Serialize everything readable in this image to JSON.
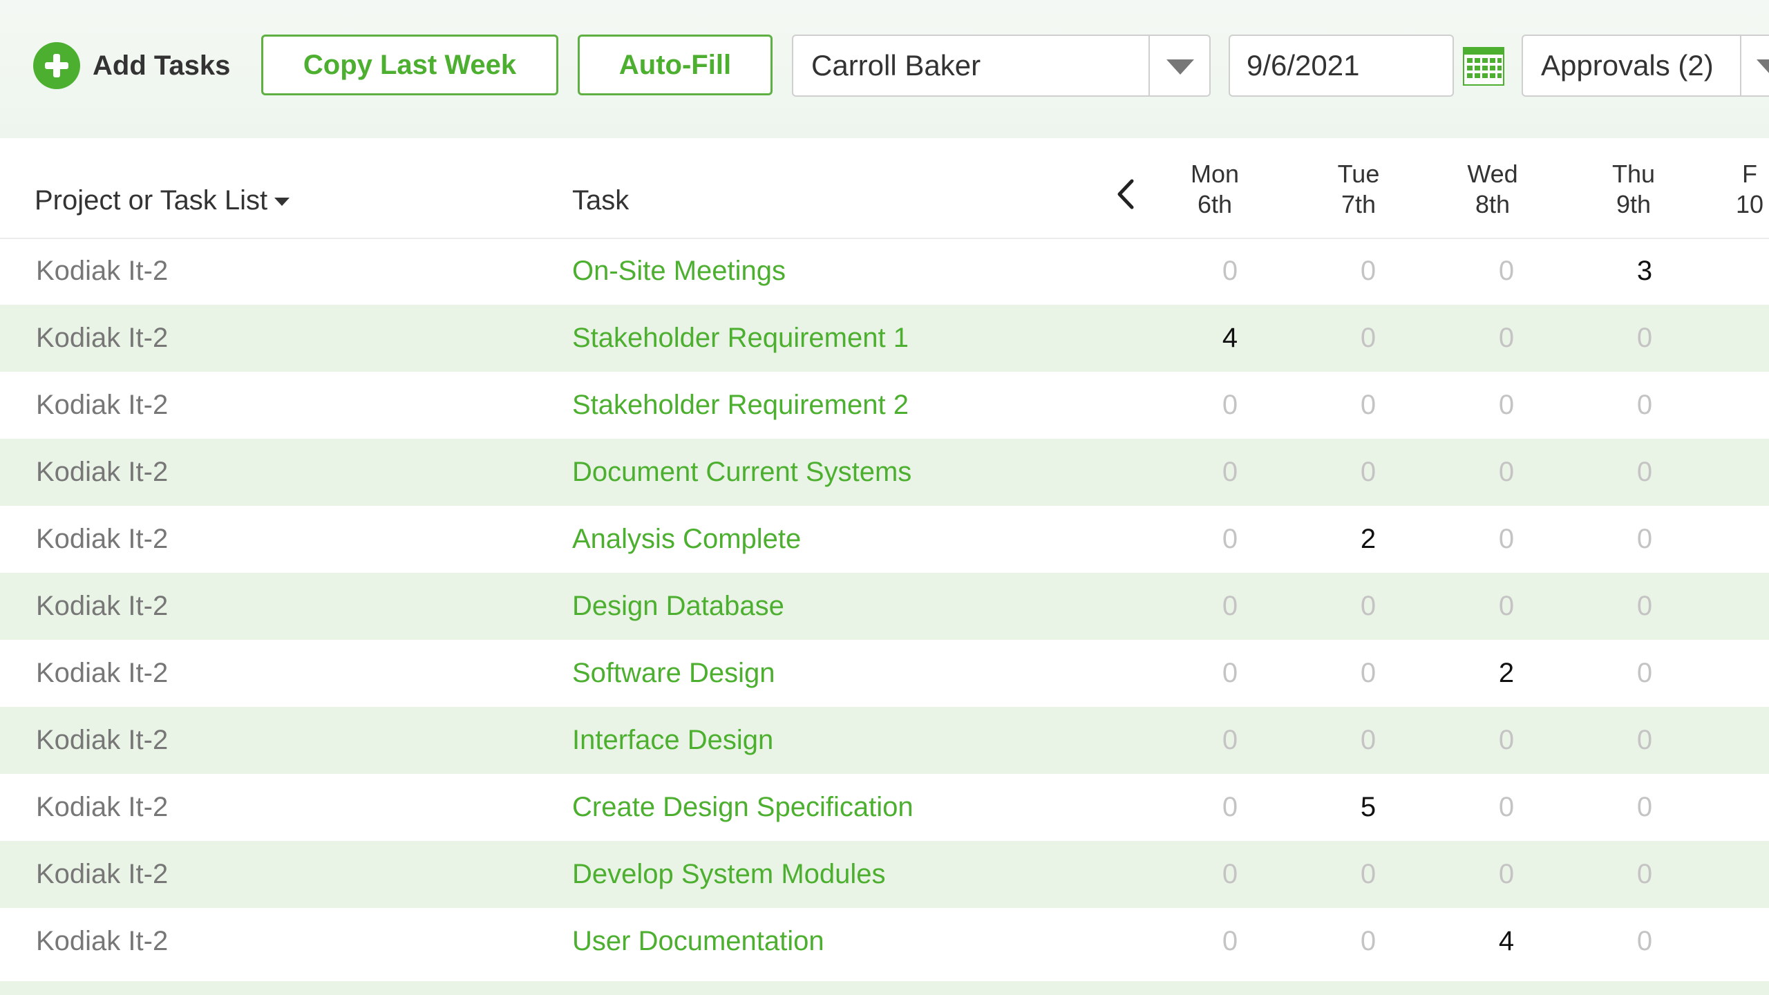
{
  "toolbar": {
    "add_tasks_label": "Add Tasks",
    "copy_last_week_label": "Copy Last Week",
    "auto_fill_label": "Auto-Fill",
    "user_select_value": "Carroll Baker",
    "date_value": "9/6/2021",
    "approvals_label": "Approvals (2)",
    "accent_color": "#4caf2f",
    "icons": [
      "plus-circle-icon",
      "chevron-down-icon",
      "calendar-icon",
      "chevron-left-icon"
    ]
  },
  "table": {
    "col_project": "Project or Task List",
    "col_task": "Task",
    "days": [
      {
        "day": "Mon",
        "date": "6th"
      },
      {
        "day": "Tue",
        "date": "7th"
      },
      {
        "day": "Wed",
        "date": "8th"
      },
      {
        "day": "Thu",
        "date": "9th"
      },
      {
        "day": "F",
        "date": "10"
      }
    ],
    "rows": [
      {
        "project": "Kodiak It-2",
        "task": "On-Site Meetings",
        "hours": [
          "0",
          "0",
          "0",
          "3"
        ]
      },
      {
        "project": "Kodiak It-2",
        "task": "Stakeholder Requirement 1",
        "hours": [
          "4",
          "0",
          "0",
          "0"
        ]
      },
      {
        "project": "Kodiak It-2",
        "task": "Stakeholder Requirement 2",
        "hours": [
          "0",
          "0",
          "0",
          "0"
        ]
      },
      {
        "project": "Kodiak It-2",
        "task": "Document Current Systems",
        "hours": [
          "0",
          "0",
          "0",
          "0"
        ]
      },
      {
        "project": "Kodiak It-2",
        "task": "Analysis Complete",
        "hours": [
          "0",
          "2",
          "0",
          "0"
        ]
      },
      {
        "project": "Kodiak It-2",
        "task": "Design Database",
        "hours": [
          "0",
          "0",
          "0",
          "0"
        ]
      },
      {
        "project": "Kodiak It-2",
        "task": "Software Design",
        "hours": [
          "0",
          "0",
          "2",
          "0"
        ]
      },
      {
        "project": "Kodiak It-2",
        "task": "Interface Design",
        "hours": [
          "0",
          "0",
          "0",
          "0"
        ]
      },
      {
        "project": "Kodiak It-2",
        "task": "Create Design Specification",
        "hours": [
          "0",
          "5",
          "0",
          "0"
        ]
      },
      {
        "project": "Kodiak It-2",
        "task": "Develop System Modules",
        "hours": [
          "0",
          "0",
          "0",
          "0"
        ]
      },
      {
        "project": "Kodiak It-2",
        "task": "User Documentation",
        "hours": [
          "0",
          "0",
          "4",
          "0"
        ]
      }
    ]
  }
}
